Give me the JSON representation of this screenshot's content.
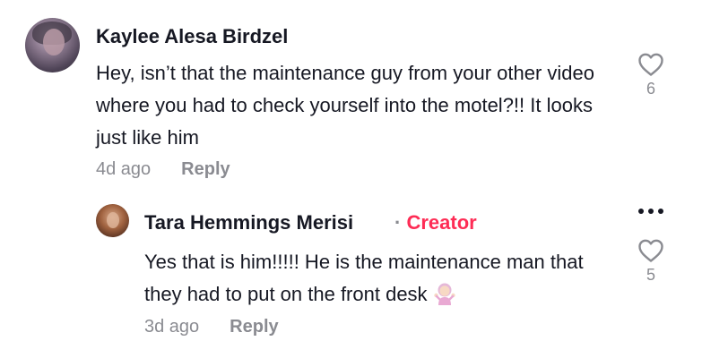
{
  "comment": {
    "username": "Kaylee Alesa Birdzel",
    "text": "Hey, isn’t that the maintenance guy from your other video where you had to check yourself into the motel?!! It looks just like him",
    "time": "4d ago",
    "reply_label": "Reply",
    "likes": "6"
  },
  "reply": {
    "username": "Tara Hemmings Merisi",
    "separator": "·",
    "badge": "Creator",
    "text": "Yes that is him!!!!! He is the maintenance man that they had to put on the front desk",
    "emoji": "person-shrugging",
    "time": "3d ago",
    "reply_label": "Reply",
    "likes": "5"
  },
  "colors": {
    "text": "#161823",
    "muted": "#8a8b91",
    "creator": "#fe2c55"
  }
}
